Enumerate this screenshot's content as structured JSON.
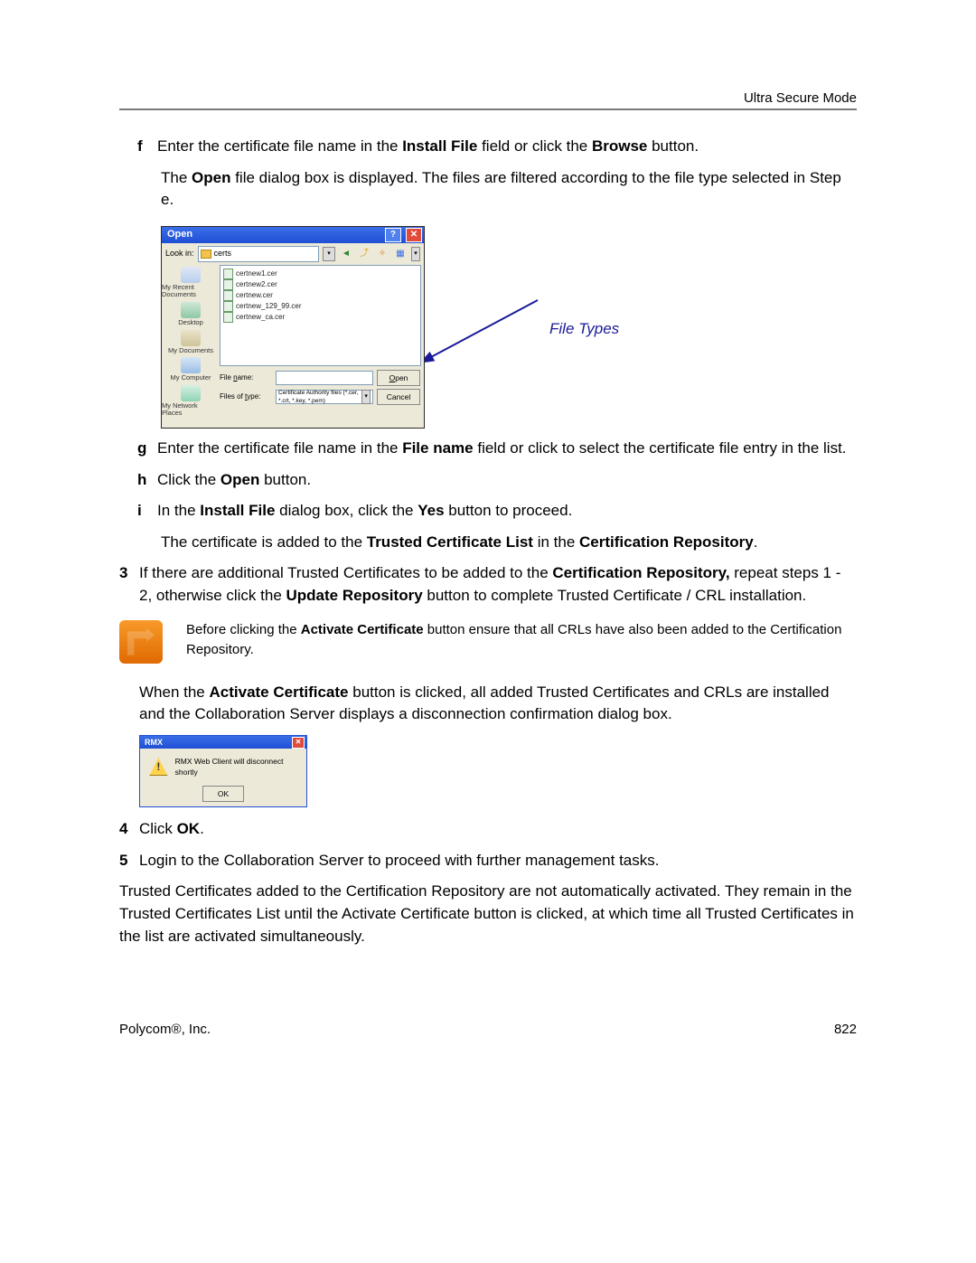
{
  "header": {
    "section": "Ultra Secure Mode"
  },
  "steps": {
    "f": {
      "marker": "f",
      "text1_a": "Enter the certificate file name in the ",
      "text1_b": "Install File",
      "text1_c": " field or click the ",
      "text1_d": "Browse",
      "text1_e": " button.",
      "text2_a": "The ",
      "text2_b": "Open",
      "text2_c": " file dialog box is displayed. The files are filtered according to the file type selected in Step e."
    },
    "g": {
      "marker": "g",
      "a": "Enter the certificate file name in the ",
      "b": "File name",
      "c": " field or click to select the certificate file entry in the list."
    },
    "h": {
      "marker": "h",
      "a": "Click the ",
      "b": "Open",
      "c": " button."
    },
    "i": {
      "marker": "i",
      "a": "In the ",
      "b": "Install File",
      "c": " dialog box, click the ",
      "d": "Yes",
      "e": " button to proceed.",
      "line2_a": "The certificate is added to the ",
      "line2_b": "Trusted Certificate List",
      "line2_c": " in the ",
      "line2_d": "Certification Repository",
      "line2_e": "."
    },
    "s3": {
      "marker": "3",
      "a": "If there are additional Trusted Certificates to be added to the ",
      "b": "Certification Repository,",
      "c": " repeat steps 1 - 2, otherwise click the ",
      "d": "Update Repository",
      "e": " button to complete Trusted Certificate / CRL installation."
    },
    "note": {
      "a": "Before clicking the ",
      "b": "Activate Certificate",
      "c": " button ensure that all CRLs have also been added to the Certification Repository."
    },
    "after_note": {
      "a": "When the ",
      "b": "Activate Certificate",
      "c": " button is clicked, all added Trusted Certificates and CRLs are installed and the Collaboration Server displays a disconnection confirmation dialog box."
    },
    "s4": {
      "marker": "4",
      "a": "Click ",
      "b": "OK",
      "c": "."
    },
    "s5": {
      "marker": "5",
      "a": "Login to the Collaboration Server to proceed with further management tasks."
    },
    "closing": "Trusted Certificates added to the Certification Repository are not automatically activated. They remain in the Trusted Certificates List until the Activate Certificate button is clicked, at which time all Trusted Certificates in the list are activated simultaneously."
  },
  "open_dialog": {
    "title": "Open",
    "lookin_label": "Look in:",
    "lookin_value": "certs",
    "files": [
      "certnew1.cer",
      "certnew2.cer",
      "certnew.cer",
      "certnew_129_99.cer",
      "certnew_ca.cer"
    ],
    "places": [
      "My Recent Documents",
      "Desktop",
      "My Documents",
      "My Computer",
      "My Network Places"
    ],
    "filename_label": "File name:",
    "filename_value": "",
    "type_label": "Files of type:",
    "type_value": "Certificate Authority files (*.cer, *.crt, *.key, *.pem)",
    "open_btn": "Open",
    "cancel_btn": "Cancel"
  },
  "annotation": {
    "file_types": "File Types"
  },
  "rmx_dialog": {
    "title": "RMX",
    "message": "RMX Web Client will disconnect shortly",
    "ok": "OK"
  },
  "footer": {
    "left": "Polycom®, Inc.",
    "right": "822"
  }
}
